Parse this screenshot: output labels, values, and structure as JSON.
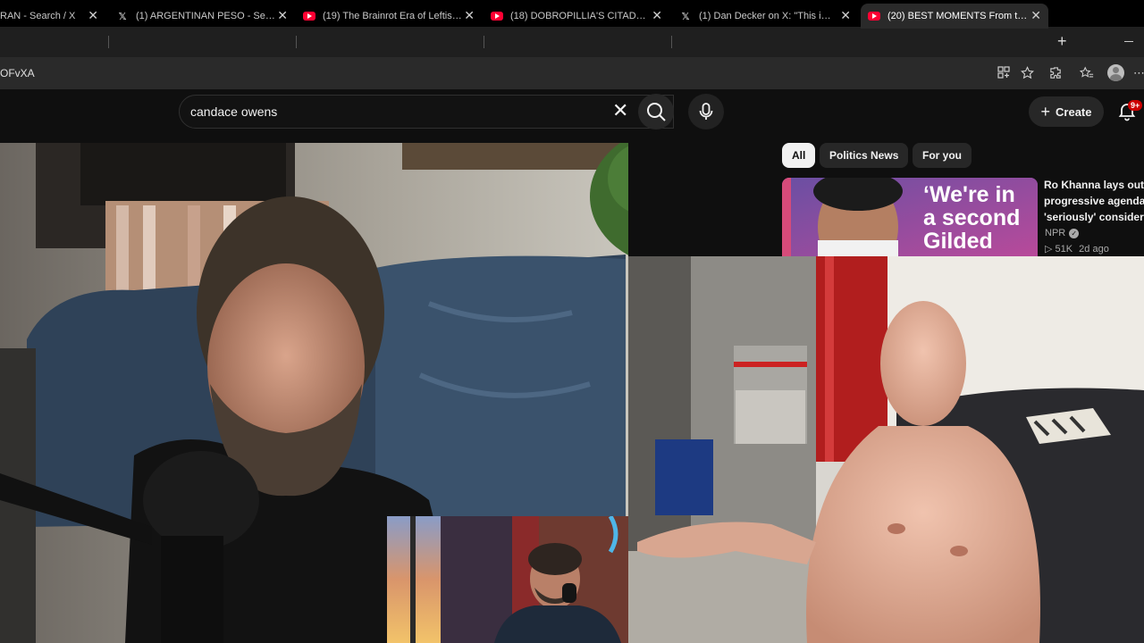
{
  "browser": {
    "tabs": [
      {
        "title": "RAN - Search / X",
        "icon": "x-logo-icon"
      },
      {
        "title": "(1) ARGENTINAN PESO - Search /",
        "icon": "x-logo-icon"
      },
      {
        "title": "(19) The Brainrot Era of Leftist Me",
        "icon": "youtube-icon"
      },
      {
        "title": "(18) DOBROPILLIA'S CITADEL UN",
        "icon": "youtube-icon"
      },
      {
        "title": "(1) Dan Decker on X: \"This is the r",
        "icon": "x-logo-icon"
      },
      {
        "title": "(20) BEST MOMENTS From the Ar",
        "icon": "youtube-icon",
        "active": true
      }
    ],
    "url": "OFvXA"
  },
  "youtube": {
    "search_query": "candace owens",
    "create_label": "Create",
    "notification_count": "9+",
    "chips": [
      "All",
      "Politics News",
      "For you"
    ],
    "recommended": {
      "thumb_text": [
        "‘We're in",
        "a second",
        "Gilded"
      ],
      "title_lines": [
        "Ro Khanna lays out",
        "progressive agenda",
        "'seriously' considers"
      ],
      "channel": "NPR",
      "views": "51K",
      "age": "2d ago"
    }
  },
  "colors": {
    "accent_red": "#ff0033",
    "badge_red": "#cc0000",
    "background": "#0f0f0f"
  }
}
